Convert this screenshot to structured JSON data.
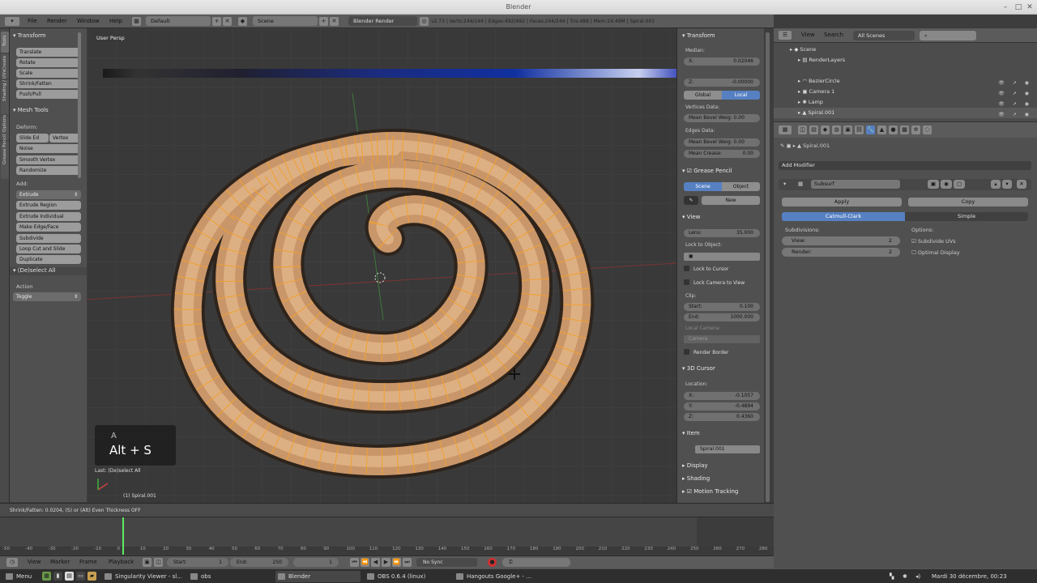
{
  "window": {
    "title": "Blender"
  },
  "info_header": {
    "menus": [
      "File",
      "Render",
      "Window",
      "Help"
    ],
    "screen_layout": "Default",
    "scene": "Scene",
    "engine": "Blender Render",
    "stats": "v2.73 | Verts:244/244 | Edges:492/492 | Faces:244/244 | Tris:488 | Mem:24.49M | Spiral.001"
  },
  "tool_tabs": [
    "Tools",
    "Create",
    "Shading / UVs",
    "Options",
    "Grease Pencil"
  ],
  "tool_shelf": {
    "transform_header": "Transform",
    "transform_buttons": [
      "Translate",
      "Rotate",
      "Scale",
      "Shrink/Fatten",
      "Push/Pull"
    ],
    "mesh_tools_header": "Mesh Tools",
    "deform_label": "Deform:",
    "deform_row": [
      "Slide Ed",
      "Vertex"
    ],
    "deform_buttons": [
      "Noise",
      "Smooth Vertex",
      "Randomize"
    ],
    "add_label": "Add:",
    "add_dropdown": "Extrude",
    "add_buttons": [
      "Extrude Region",
      "Extrude Individual",
      "Make Edge/Face",
      "Subdivide",
      "Loop Cut and Slide",
      "Duplicate"
    ],
    "operator_header": "(De)select All",
    "action_label": "Action",
    "action_value": "Toggle"
  },
  "viewport": {
    "view_label": "User Persp",
    "keycast_top": "A",
    "keycast_main": "Alt + S",
    "last_op": "Last: (De)select All",
    "object_label": "(1) Spiral.001"
  },
  "npanel": {
    "transform_header": "Transform",
    "median_label": "Median:",
    "x_label": "X:",
    "x_value": "0.02046",
    "z_label": "Z:",
    "z_value": "-0.00000",
    "global_btn": "Global",
    "local_btn": "Local",
    "vertex_data": "Vertices Data:",
    "mean_bevel_weight_v": "Mean Bevel Weig: 0.00",
    "edges_data": "Edges Data:",
    "mean_bevel_weight_e": "Mean Bevel Weig: 0.00",
    "mean_crease": "Mean Crease:",
    "mean_crease_value": "0.00",
    "grease_pencil_header": "Grease Pencil",
    "scene_btn": "Scene",
    "object_btn": "Object",
    "new_btn": "New",
    "view_header": "View",
    "lens_label": "Lens:",
    "lens_value": "35.000",
    "lock_to_object": "Lock to Object:",
    "lock_to_cursor": "Lock to Cursor",
    "lock_camera_view": "Lock Camera to View",
    "clip_label": "Clip:",
    "start_label": "Start:",
    "start_value": "0.100",
    "end_label": "End:",
    "end_value": "1000.000",
    "local_camera": "Local Camera:",
    "camera_field": "Camera",
    "render_border": "Render Border",
    "cursor_header": "3D Cursor",
    "location_label": "Location:",
    "cx_label": "X:",
    "cx_value": "-0.1057",
    "cy_label": "Y:",
    "cy_value": "-0.4894",
    "cz_label": "Z:",
    "cz_value": "0.4360",
    "item_header": "Item",
    "item_name": "Spiral.001",
    "display_header": "Display",
    "shading_header": "Shading",
    "motion_tracking_header": "Motion Tracking"
  },
  "outliner": {
    "view_menu": "View",
    "search_menu": "Search",
    "filter_dropdown": "All Scenes",
    "rows": [
      "Scene",
      "RenderLayers",
      "BezierCircle",
      "Camera",
      "Lamp",
      "Spiral.001"
    ],
    "camera_badge": "1"
  },
  "properties": {
    "breadcrumb": "Spiral.001",
    "add_modifier": "Add Modifier",
    "modifier_name": "Subsurf",
    "apply_btn": "Apply",
    "copy_btn": "Copy",
    "catmull_btn": "Catmull-Clark",
    "simple_btn": "Simple",
    "subdivisions_label": "Subdivisions:",
    "view_field": "View:",
    "view_value": "2",
    "render_field": "Render:",
    "render_value": "2",
    "options_label": "Options:",
    "subdivide_uvs": "Subdivide UVs",
    "optimal_display": "Optimal Display"
  },
  "status_line": "Shrink/Fatten: 0.0204, (S) or (Alt) Even Thickness OFF",
  "timeline": {
    "ticks": [
      "-50",
      "-40",
      "-30",
      "-20",
      "-10",
      "0",
      "10",
      "20",
      "30",
      "40",
      "50",
      "60",
      "70",
      "80",
      "90",
      "100",
      "110",
      "120",
      "130",
      "140",
      "150",
      "160",
      "170",
      "180",
      "190",
      "200",
      "210",
      "220",
      "230",
      "240",
      "250",
      "260",
      "270",
      "280"
    ],
    "current_frame_value": 0,
    "menus": [
      "View",
      "Marker",
      "Frame",
      "Playback"
    ],
    "start_label": "Start:",
    "start_value": "1",
    "end_label": "End:",
    "end_value": "250",
    "current_frame": "1",
    "sync": "No Sync"
  },
  "taskbar": {
    "menu": "Menu",
    "tasks": [
      "Singularity Viewer - sl...",
      "obs",
      "Blender",
      "OBS 0.6.4 (linux)",
      "Hangouts Google+ - ..."
    ],
    "clock": "Mardi 30 décembre, 00:23"
  }
}
